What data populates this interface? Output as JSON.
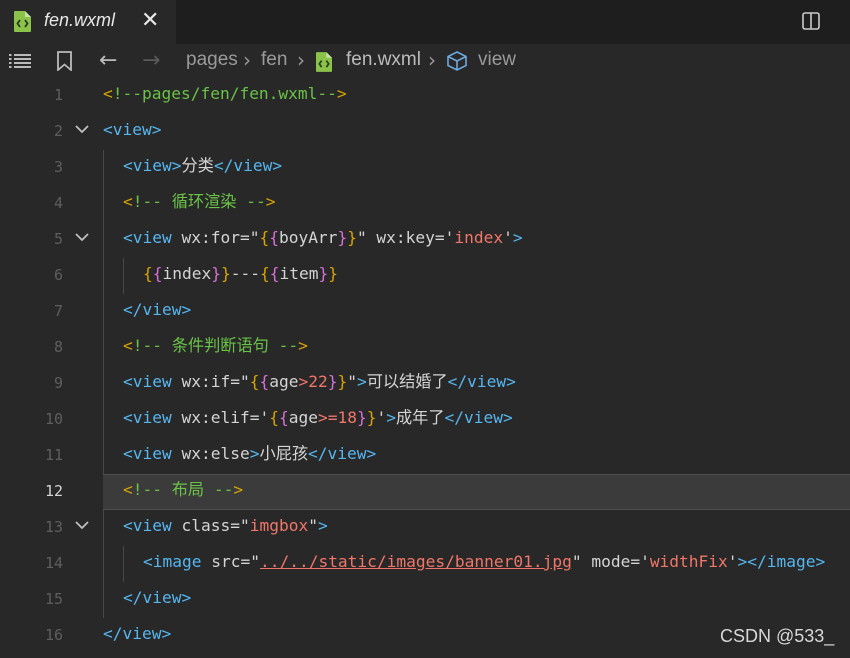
{
  "tab": {
    "title": "fen.wxml",
    "close_symbol": "✕"
  },
  "breadcrumb": {
    "items": [
      "pages",
      "fen",
      "fen.wxml",
      "view"
    ]
  },
  "editor": {
    "current_line": 12,
    "lines": [
      {
        "n": "1",
        "tokens": [
          [
            "br",
            "<"
          ],
          [
            "cm",
            "!--pages/fen/fen.wxml--"
          ],
          [
            "br",
            ">"
          ]
        ]
      },
      {
        "n": "2",
        "tokens": [
          [
            "tg",
            "<view>"
          ]
        ]
      },
      {
        "n": "3",
        "tokens": [
          [
            "tg",
            "<view>"
          ],
          [
            "pl",
            "分类"
          ],
          [
            "tg",
            "</view>"
          ]
        ]
      },
      {
        "n": "4",
        "tokens": [
          [
            "br",
            "<"
          ],
          [
            "cm",
            "!-- 循环渲染 --"
          ],
          [
            "br",
            ">"
          ]
        ]
      },
      {
        "n": "5",
        "tokens": [
          [
            "tg",
            "<view "
          ],
          [
            "at",
            "wx:for=\""
          ],
          [
            "br",
            "{"
          ],
          [
            "br2",
            "{"
          ],
          [
            "at",
            "boyArr"
          ],
          [
            "br2",
            "}"
          ],
          [
            "br",
            "}"
          ],
          [
            "at",
            "\" wx:key='"
          ],
          [
            "st",
            "index"
          ],
          [
            "at",
            "'"
          ],
          [
            "tg",
            ">"
          ]
        ]
      },
      {
        "n": "6",
        "tokens": [
          [
            "br",
            "{"
          ],
          [
            "br2",
            "{"
          ],
          [
            "at",
            "index"
          ],
          [
            "br2",
            "}"
          ],
          [
            "br",
            "}"
          ],
          [
            "at",
            "---"
          ],
          [
            "br",
            "{"
          ],
          [
            "br2",
            "{"
          ],
          [
            "at",
            "item"
          ],
          [
            "br2",
            "}"
          ],
          [
            "br",
            "}"
          ]
        ]
      },
      {
        "n": "7",
        "tokens": [
          [
            "tg",
            "</view>"
          ]
        ]
      },
      {
        "n": "8",
        "tokens": [
          [
            "br",
            "<"
          ],
          [
            "cm",
            "!-- 条件判断语句 --"
          ],
          [
            "br",
            ">"
          ]
        ]
      },
      {
        "n": "9",
        "tokens": [
          [
            "tg",
            "<view "
          ],
          [
            "at",
            "wx:if=\""
          ],
          [
            "br",
            "{"
          ],
          [
            "br2",
            "{"
          ],
          [
            "at",
            "age"
          ],
          [
            "op",
            ">"
          ],
          [
            "num",
            "22"
          ],
          [
            "br2",
            "}"
          ],
          [
            "br",
            "}"
          ],
          [
            "at",
            "\""
          ],
          [
            "tg",
            ">"
          ],
          [
            "pl",
            "可以结婚了"
          ],
          [
            "tg",
            "</view>"
          ]
        ]
      },
      {
        "n": "10",
        "tokens": [
          [
            "tg",
            "<view "
          ],
          [
            "at",
            "wx:elif='"
          ],
          [
            "br",
            "{"
          ],
          [
            "br2",
            "{"
          ],
          [
            "at",
            "age"
          ],
          [
            "op",
            ">="
          ],
          [
            "num",
            "18"
          ],
          [
            "br2",
            "}"
          ],
          [
            "br",
            "}"
          ],
          [
            "at",
            "'"
          ],
          [
            "tg",
            ">"
          ],
          [
            "pl",
            "成年了"
          ],
          [
            "tg",
            "</view>"
          ]
        ]
      },
      {
        "n": "11",
        "tokens": [
          [
            "tg",
            "<view "
          ],
          [
            "at",
            "wx:else"
          ],
          [
            "tg",
            ">"
          ],
          [
            "pl",
            "小屁孩"
          ],
          [
            "tg",
            "</view>"
          ]
        ]
      },
      {
        "n": "12",
        "tokens": [
          [
            "br",
            "<"
          ],
          [
            "cm",
            "!-- 布局 --"
          ],
          [
            "br",
            ">"
          ]
        ]
      },
      {
        "n": "13",
        "tokens": [
          [
            "tg",
            "<view "
          ],
          [
            "at",
            "class=\""
          ],
          [
            "st",
            "imgbox"
          ],
          [
            "at",
            "\""
          ],
          [
            "tg",
            ">"
          ]
        ]
      },
      {
        "n": "14",
        "tokens": [
          [
            "tg",
            "<image "
          ],
          [
            "at",
            "src=\""
          ],
          [
            "url",
            "../../static/images/banner01.jpg"
          ],
          [
            "at",
            "\" mode='"
          ],
          [
            "st",
            "widthFix"
          ],
          [
            "at",
            "'"
          ],
          [
            "tg",
            "></image>"
          ]
        ]
      },
      {
        "n": "15",
        "tokens": [
          [
            "tg",
            "</view>"
          ]
        ]
      },
      {
        "n": "16",
        "tokens": [
          [
            "tg",
            "</view>"
          ]
        ]
      }
    ]
  },
  "watermark": "CSDN @533_",
  "colors": {
    "background": "#282828",
    "tag": "#56b6f0",
    "comment": "#6ac247",
    "string": "#f07669",
    "bracket": "#d8a400",
    "inner_bracket": "#d670d6",
    "file_icon": "#8bc34a"
  }
}
